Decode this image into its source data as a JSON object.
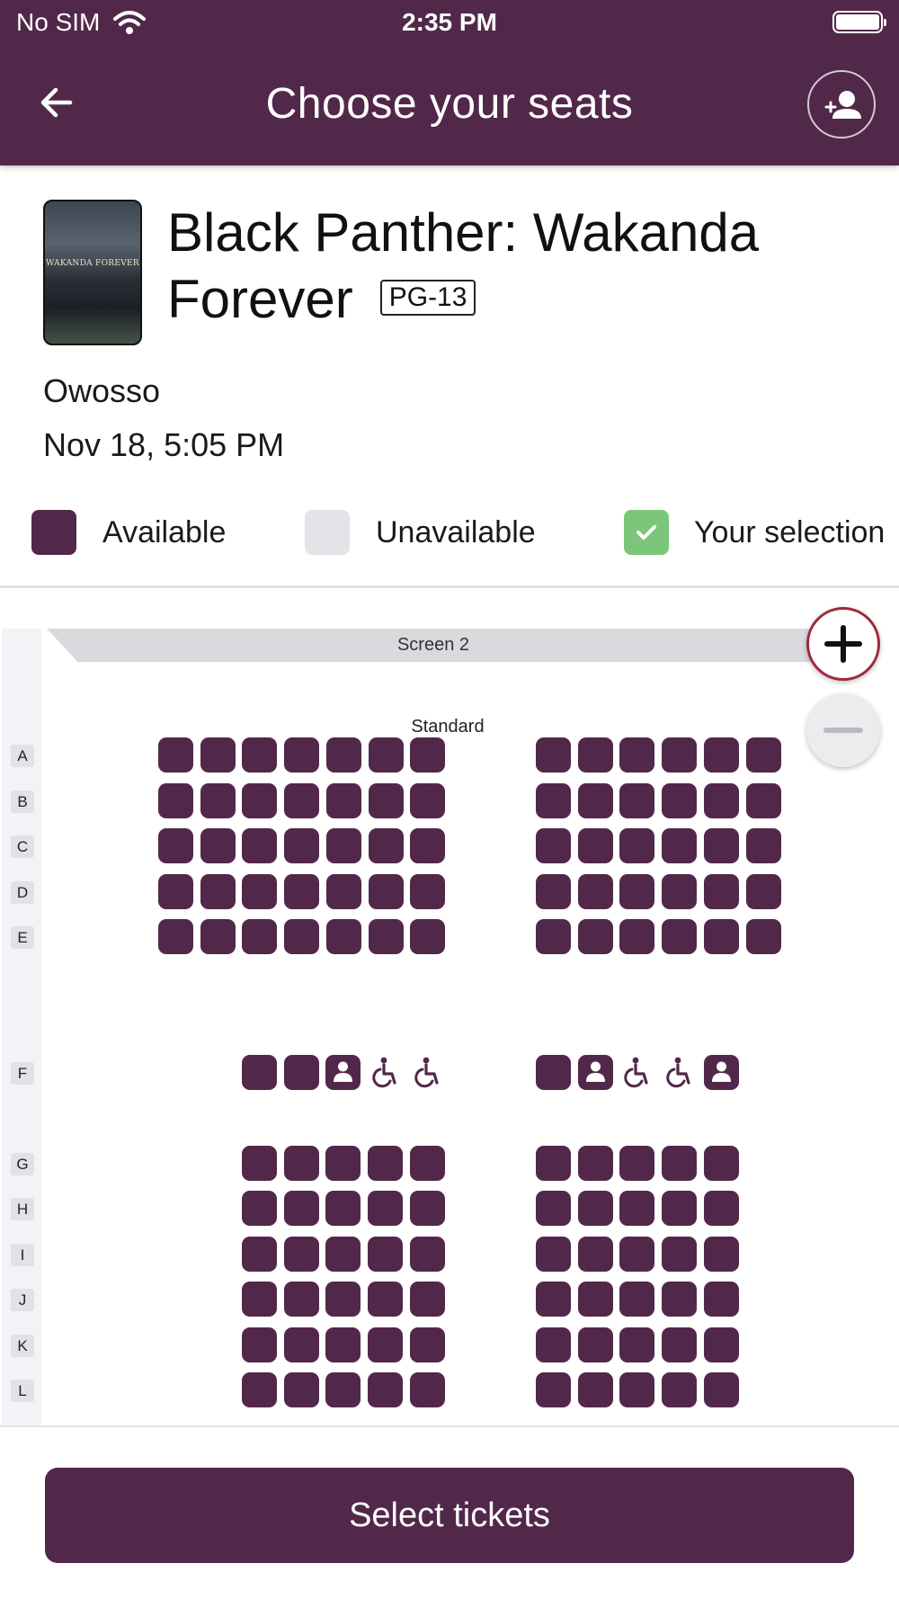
{
  "status_bar": {
    "carrier": "No SIM",
    "time": "2:35 PM"
  },
  "header": {
    "title": "Choose your seats",
    "back_icon": "arrow-left-icon",
    "account_icon": "add-user-icon"
  },
  "movie": {
    "poster_text": "WAKANDA FOREVER",
    "title": "Black Panther: Wakanda Forever",
    "rating": "PG-13",
    "location": "Owosso",
    "datetime": "Nov 18, 5:05 PM"
  },
  "legend": [
    {
      "label": "Available",
      "color": "#52284a"
    },
    {
      "label": "Unavailable",
      "color": "#e3e3e8"
    },
    {
      "label": "Your selection",
      "color": "#7cc67a"
    }
  ],
  "seat_map": {
    "screen_label": "Screen 2",
    "section_label": "Standard",
    "seat_color": "#52284a",
    "rows": [
      "A",
      "B",
      "C",
      "D",
      "E",
      "F",
      "G",
      "H",
      "I",
      "J",
      "K",
      "L"
    ],
    "row_F": {
      "left": [
        "seat",
        "seat",
        "companion",
        "wheelchair",
        "wheelchair"
      ],
      "right": [
        "seat",
        "companion",
        "wheelchair",
        "wheelchair",
        "companion"
      ]
    }
  },
  "zoom": {
    "in_icon": "plus-icon",
    "out_icon": "minus-icon"
  },
  "footer": {
    "cta_label": "Select tickets"
  }
}
